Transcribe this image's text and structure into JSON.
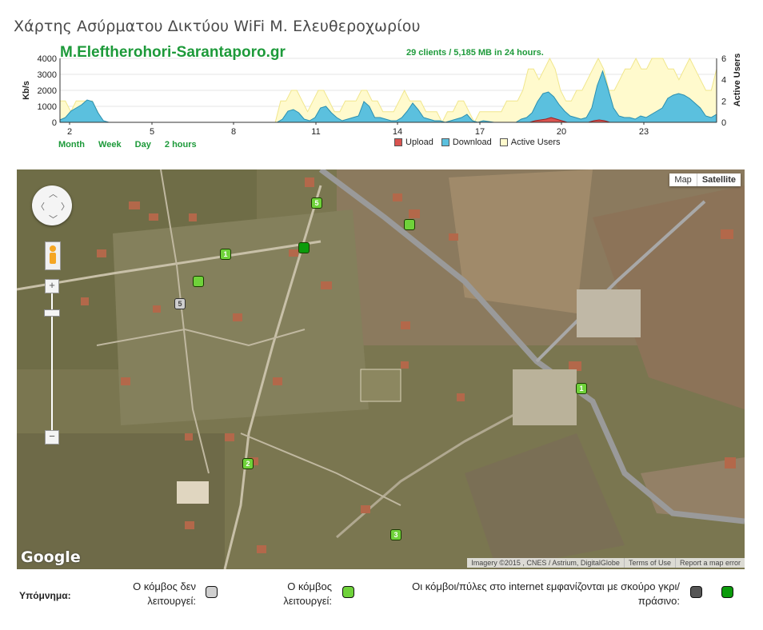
{
  "page": {
    "title": "Χάρτης Ασύρματου Δικτύου WiFi Μ. Ελευθεροχωρίου"
  },
  "chart": {
    "title": "M.Eleftherohori-Sarantaporo.gr",
    "subtitle": "29 clients / 5,185 MB in 24 hours.",
    "range_links": [
      "Month",
      "Week",
      "Day",
      "2 hours"
    ],
    "left_axis_label": "Kb/s",
    "right_axis_label": "Active Users",
    "legend": {
      "upload": "Upload",
      "download": "Download",
      "active_users": "Active Users"
    }
  },
  "chart_data": {
    "type": "area",
    "x_ticks": [
      "2",
      "5",
      "8",
      "11",
      "14",
      "17",
      "20",
      "23"
    ],
    "y_left_ticks": [
      "0",
      "1000",
      "2000",
      "3000",
      "4000"
    ],
    "y_right_ticks": [
      "0",
      "2",
      "4",
      "6"
    ],
    "ylim_left": [
      0,
      4000
    ],
    "ylim_right": [
      0,
      6
    ],
    "colors": {
      "upload": "#d9534f",
      "download": "#5bc0de",
      "active_users": "#fffacd",
      "active_users_line": "#f0e68c"
    },
    "series": [
      {
        "name": "Download",
        "values": [
          150,
          300,
          700,
          900,
          1100,
          1400,
          1300,
          600,
          100,
          0,
          0,
          0,
          0,
          0,
          0,
          0,
          0,
          0,
          0,
          0,
          0,
          0,
          0,
          0,
          0,
          0,
          0,
          0,
          0,
          0,
          0,
          0,
          0,
          0,
          0,
          0,
          0,
          0,
          0,
          0,
          0,
          200,
          700,
          800,
          600,
          200,
          100,
          300,
          900,
          1000,
          600,
          300,
          100,
          200,
          300,
          400,
          1300,
          1000,
          300,
          300,
          200,
          100,
          100,
          300,
          700,
          1200,
          800,
          300,
          200,
          100,
          100,
          0,
          100,
          200,
          300,
          500,
          100,
          0,
          100,
          50,
          0,
          0,
          0,
          0,
          0,
          200,
          300,
          600,
          1300,
          1800,
          1900,
          1600,
          1100,
          700,
          400,
          300,
          200,
          300,
          900,
          2300,
          3200,
          2100,
          900,
          400,
          300,
          300,
          200,
          400,
          300,
          500,
          700,
          900,
          1500,
          1700,
          1800,
          1700,
          1500,
          1200,
          900,
          400,
          300,
          500
        ]
      },
      {
        "name": "Upload",
        "values": [
          0,
          0,
          0,
          0,
          0,
          0,
          0,
          0,
          0,
          0,
          0,
          0,
          0,
          0,
          0,
          0,
          0,
          0,
          0,
          0,
          0,
          0,
          0,
          0,
          0,
          0,
          0,
          0,
          0,
          0,
          0,
          0,
          0,
          0,
          0,
          0,
          0,
          0,
          0,
          0,
          0,
          0,
          0,
          0,
          0,
          0,
          0,
          0,
          0,
          0,
          0,
          0,
          0,
          0,
          0,
          0,
          0,
          0,
          0,
          0,
          0,
          0,
          0,
          0,
          0,
          0,
          0,
          0,
          0,
          0,
          0,
          0,
          0,
          0,
          0,
          0,
          0,
          0,
          0,
          0,
          0,
          0,
          0,
          0,
          0,
          0,
          0,
          0,
          0,
          100,
          150,
          200,
          300,
          200,
          100,
          0,
          0,
          0,
          0,
          0,
          100,
          150,
          100,
          0,
          0,
          0,
          0,
          0,
          0,
          0,
          0,
          0,
          0,
          0,
          0,
          0,
          0,
          0,
          0,
          0,
          0,
          0,
          0,
          0
        ]
      },
      {
        "name": "Active Users",
        "values": [
          2,
          2,
          1,
          2,
          2,
          2,
          2,
          1,
          0,
          0,
          0,
          0,
          0,
          0,
          0,
          0,
          0,
          0,
          0,
          0,
          0,
          0,
          0,
          0,
          0,
          0,
          0,
          0,
          0,
          0,
          0,
          0,
          0,
          0,
          0,
          0,
          0,
          0,
          0,
          0,
          0,
          2,
          2,
          3,
          3,
          2,
          1,
          2,
          3,
          3,
          2,
          1,
          1,
          2,
          2,
          2,
          3,
          3,
          2,
          2,
          1,
          1,
          1,
          2,
          3,
          2,
          2,
          2,
          1,
          1,
          1,
          0,
          1,
          1,
          2,
          2,
          1,
          0,
          1,
          1,
          1,
          1,
          1,
          2,
          2,
          2,
          3,
          5,
          5,
          4,
          5,
          6,
          5,
          3,
          2,
          2,
          3,
          3,
          4,
          5,
          6,
          5,
          3,
          3,
          4,
          5,
          5,
          6,
          5,
          5,
          6,
          6,
          6,
          5,
          5,
          4,
          5,
          6,
          5,
          4,
          3,
          3,
          5
        ]
      }
    ],
    "grid": true,
    "legend_placement": "bottom"
  },
  "map": {
    "type_buttons": [
      "Map",
      "Satellite"
    ],
    "active_type": "Satellite",
    "zoom_in": "+",
    "zoom_out": "−",
    "attribution": "Imagery ©2015 , CNES / Astrium, DigitalGlobe",
    "terms": "Terms of Use",
    "report": "Report a map error",
    "logo": "Google",
    "markers": [
      {
        "label": "5",
        "status": "ok"
      },
      {
        "label": "",
        "status": "ok"
      },
      {
        "label": "1",
        "status": "ok"
      },
      {
        "label": "",
        "status": "gateway"
      },
      {
        "label": "",
        "status": "ok"
      },
      {
        "label": "5",
        "status": "down"
      },
      {
        "label": "1",
        "status": "ok"
      },
      {
        "label": "2",
        "status": "ok"
      },
      {
        "label": "3",
        "status": "ok"
      }
    ]
  },
  "legend": {
    "label": "Υπόμνημα:",
    "down_line1": "Ο κόμβος δεν",
    "down_line2": "λειτουργεί:",
    "ok_line1": "Ο κόμβος",
    "ok_line2": "λειτουργεί:",
    "gw_line1": "Οι κόμβοι/πύλες στο internet εμφανίζονται με σκούρο γκρι/",
    "gw_line2": "πράσινο:"
  }
}
